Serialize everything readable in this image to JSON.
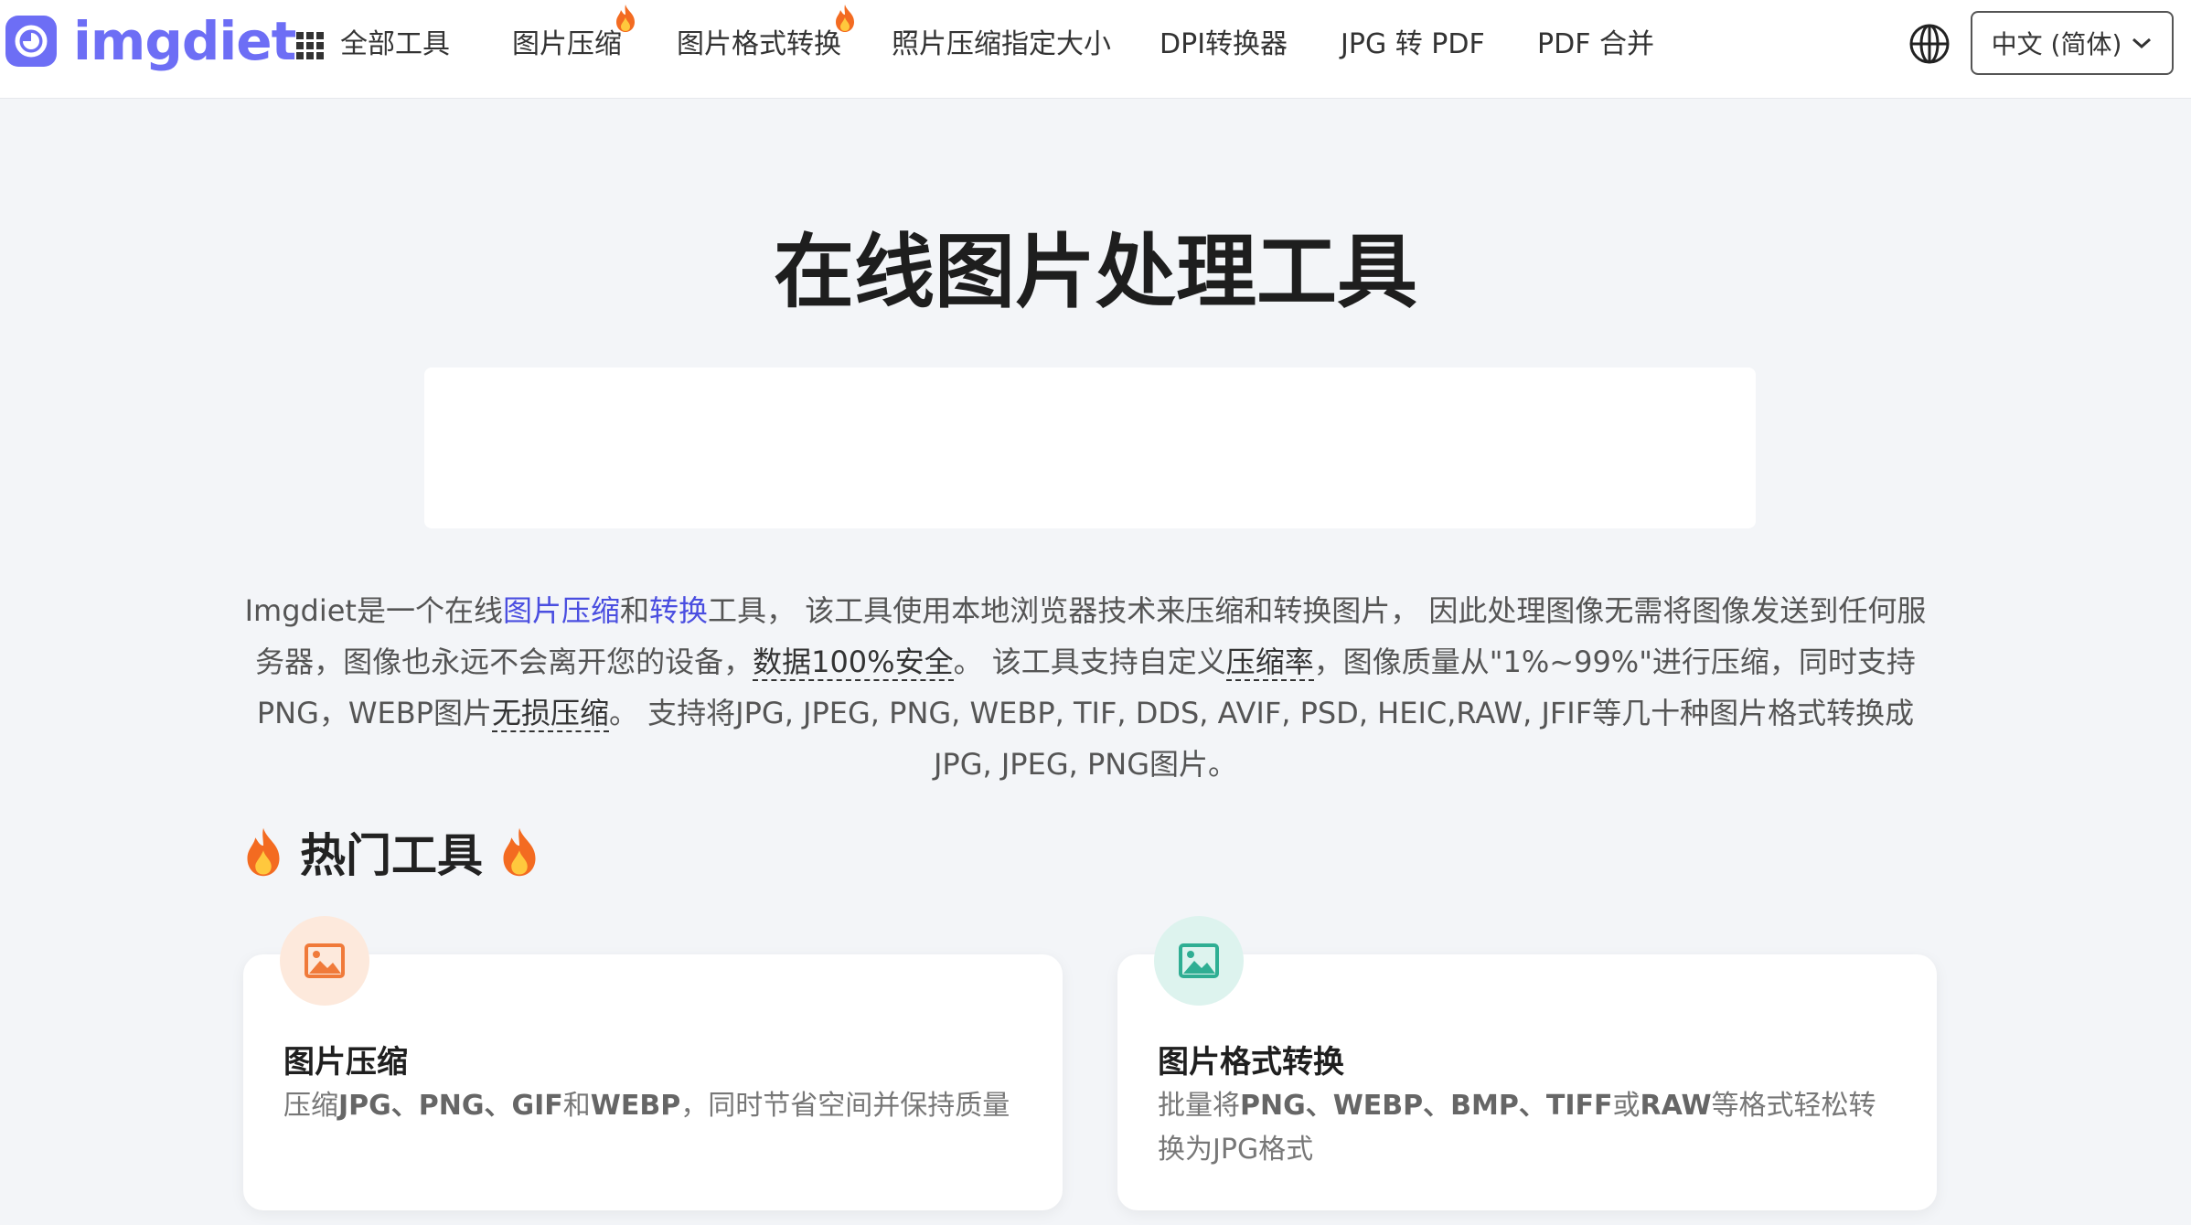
{
  "header": {
    "logo_text": "imgdiet",
    "nav": [
      {
        "label": "全部工具",
        "hot": false
      },
      {
        "label": "图片压缩",
        "hot": true
      },
      {
        "label": "图片格式转换",
        "hot": true
      },
      {
        "label": "照片压缩指定大小",
        "hot": false
      },
      {
        "label": "DPI转换器",
        "hot": false
      },
      {
        "label": "JPG 转 PDF",
        "hot": false
      },
      {
        "label": "PDF 合并",
        "hot": false
      }
    ],
    "language": "中文 (简体)"
  },
  "main": {
    "title": "在线图片处理工具",
    "intro": {
      "p1": "Imgdiet是一个在线",
      "link1": "图片压缩",
      "p2": "和",
      "link2": "转换",
      "p3": "工具， 该工具使用本地浏览器技术来压缩和转换图片， 因此处理图像无需将图像发送到任何服务器，图像也永远不会离开您的设备，",
      "term1": "数据100%安全",
      "p4": "。 该工具支持自定义",
      "term2": "压缩率",
      "p5": "，图像质量从\"1%~99%\"进行压缩，同时支持PNG，WEBP图片",
      "term3": "无损压缩",
      "p6": "。 支持将JPG, JPEG, PNG, WEBP, TIF, DDS, AVIF, PSD, HEIC,RAW, JFIF等几十种图片格式转换成JPG, JPEG, PNG图片。"
    },
    "hot_tools_title": "热门工具",
    "cards": [
      {
        "title": "图片压缩",
        "desc_parts": [
          "压缩",
          "JPG、PNG、GIF",
          "和",
          "WEBP",
          "，同时节省空间并保持质量"
        ],
        "icon": "image-icon",
        "icon_color": "#f07a3a"
      },
      {
        "title": "图片格式转换",
        "desc_parts": [
          "批量将",
          "PNG、WEBP、BMP、TIFF",
          "或",
          "RAW",
          "等格式轻松转换为JPG格式"
        ],
        "icon": "image-icon",
        "icon_color": "#2fae93"
      }
    ]
  },
  "colors": {
    "brand": "#6d6ef5",
    "link": "#4a4ee0",
    "background": "#f3f5f8"
  }
}
